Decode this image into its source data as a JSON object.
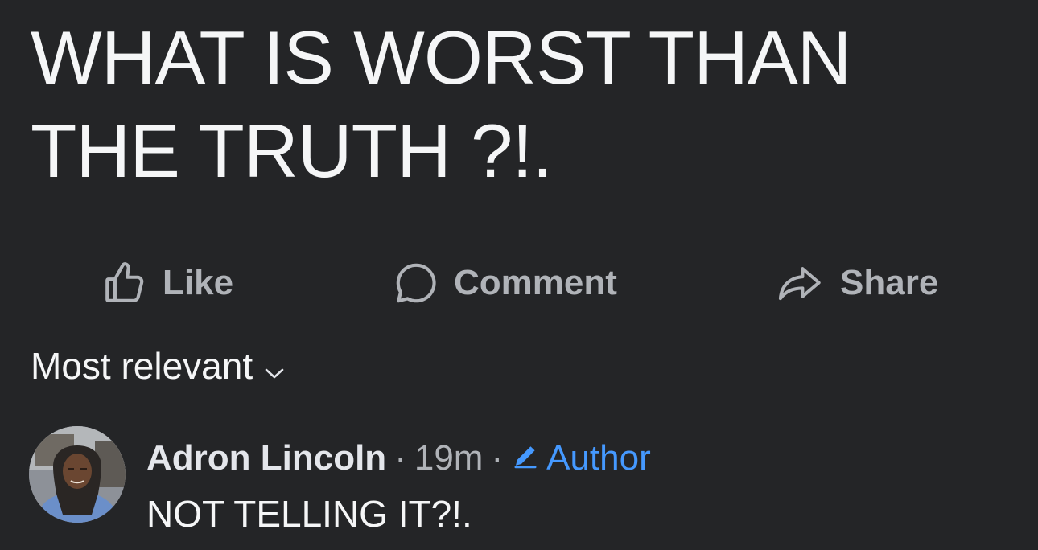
{
  "post": {
    "text": "WHAT IS WORST THAN\nTHE TRUTH ?!."
  },
  "actions": {
    "like_label": "Like",
    "comment_label": "Comment",
    "share_label": "Share"
  },
  "comments_sort": {
    "label": "Most relevant"
  },
  "comments": [
    {
      "author": "Adron Lincoln",
      "separator": "·",
      "time": "19m",
      "badge": "Author",
      "text": "NOT TELLING IT?!."
    }
  ],
  "colors": {
    "background": "#242527",
    "primary_text": "#f5f6f7",
    "secondary_text": "#b0b3b8",
    "accent": "#4599ff"
  },
  "icons": {
    "like": "thumbs-up-icon",
    "comment": "speech-bubble-icon",
    "share": "share-arrow-icon",
    "sort": "chevron-down-icon",
    "author": "pencil-icon"
  }
}
